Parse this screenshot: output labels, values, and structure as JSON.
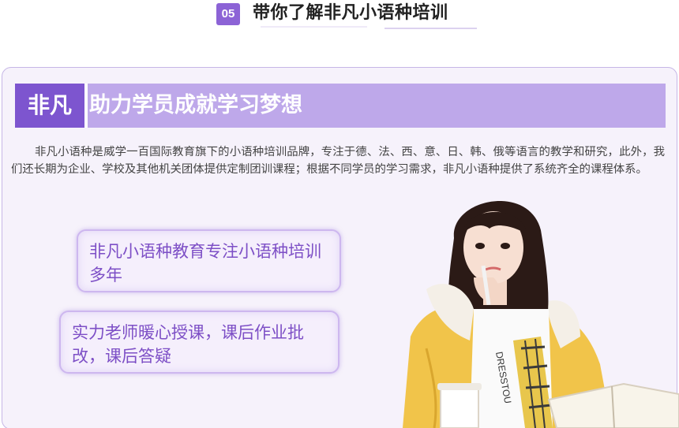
{
  "section": {
    "number": "05",
    "title": "带你了解非凡小语种培训"
  },
  "banner": {
    "brand": "非凡",
    "slogan": "助力学员成就学习梦想"
  },
  "intro": "非凡小语种是威学一百国际教育旗下的小语种培训品牌，专注于德、法、西、意、日、韩、俄等语言的教学和研究，此外，我们还长期为企业、学校及其他机关团体提供定制团训课程；根据不同学员的学习需求，非凡小语种提供了系统齐全的课程体系。",
  "features": [
    "非凡小语种教育专注小语种培训多年",
    "实力老师暖心授课，课后作业批改，课后答疑"
  ],
  "photo": {
    "shirt_print": "DRESSTOU"
  },
  "colors": {
    "accent": "#7d55cf",
    "banner": "#bea8ea",
    "card_bg": "#f6f2fb",
    "pill_text": "#7d4fc6"
  }
}
